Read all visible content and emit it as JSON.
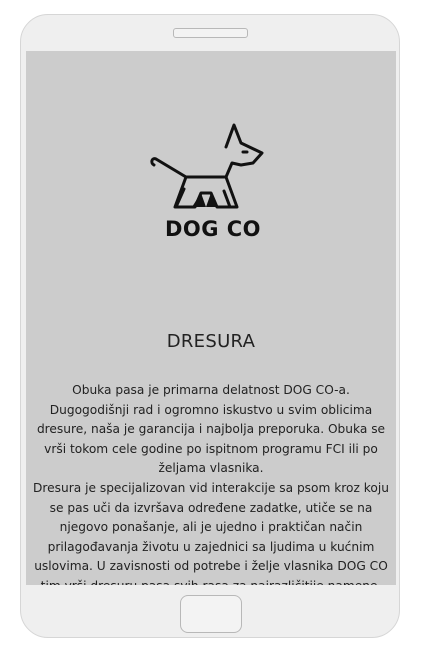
{
  "brand": "DOG CO",
  "heading": "DRESURA",
  "paragraphs": [
    "Obuka pasa je primarna delatnost DOG CO-a. Dugogodišnji rad i ogromno iskustvo u svim oblicima dresure, naša je garancija i najbolja preporuka. Obuka se vrši tokom cele godine po ispitnom programu FCI ili po željama vlasnika.",
    "Dresura je specijalizovan vid interakcije sa psom kroz koju se pas uči da izvršava određene zadatke, utiče se na njegovo ponašanje, ali je ujedno i praktičan način prilagođavanja životu u zajednici sa ljudima u kućnim uslovima. U zavisnosti od potrebe i želje vlasnika DOG CO tim vrši dresuru pasa svih rasa za najrazličitije namene. Kroz obuku pripremamo pse za službene-policijske-vojne namene, sportske, lovačke, agility i lovinske pse, kao i"
  ]
}
